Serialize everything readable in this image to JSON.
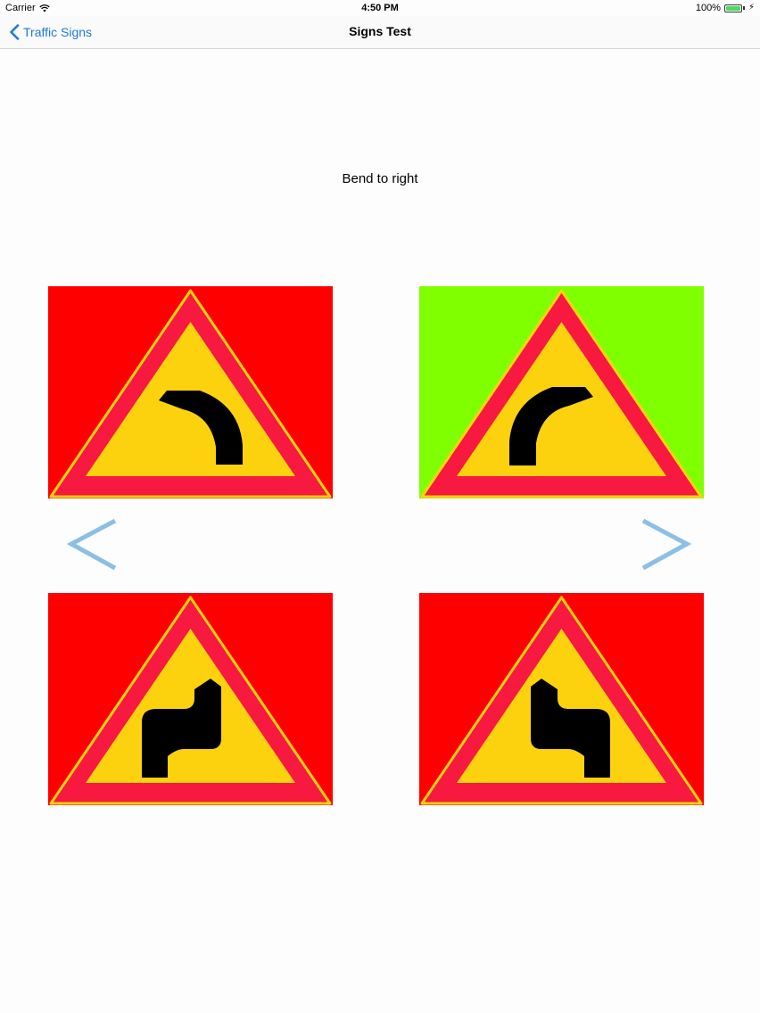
{
  "status_bar": {
    "carrier": "Carrier",
    "time": "4:50 PM",
    "battery": "100%"
  },
  "nav": {
    "back_label": "Traffic Signs",
    "title": "Signs Test"
  },
  "question": "Bend to right",
  "options": [
    {
      "sign": "bend-to-left",
      "background": "#ff0000"
    },
    {
      "sign": "bend-to-right",
      "background": "#80ff00"
    },
    {
      "sign": "double-bend-right-first",
      "background": "#ff0000"
    },
    {
      "sign": "double-bend-left-first",
      "background": "#ff0000"
    }
  ],
  "colors": {
    "accent": "#1c7bd6",
    "arrow": "#8bbfe6",
    "sign_border": "#f7193f",
    "sign_fill": "#fcd20f"
  }
}
